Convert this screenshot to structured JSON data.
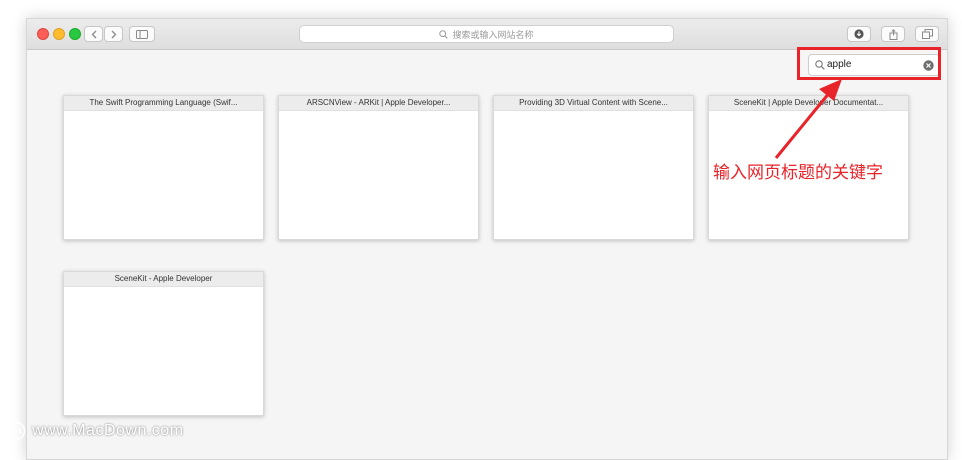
{
  "address_bar": {
    "placeholder": "搜索或输入网站名称"
  },
  "search": {
    "value": "apple"
  },
  "tabs": [
    {
      "title": "The Swift Programming Language (Swif..."
    },
    {
      "title": "ARSCNView - ARKit | Apple Developer..."
    },
    {
      "title": "Providing 3D Virtual Content with Scene..."
    },
    {
      "title": "SceneKit | Apple Developer Documentat..."
    },
    {
      "title": "SceneKit - Apple Developer"
    }
  ],
  "annotation": {
    "text": "输入网页标题的关键字"
  },
  "watermark": {
    "text": "www.MacDown.com"
  },
  "colors": {
    "annotation_red": "#e8232a",
    "window_bg": "#f5f5f5"
  }
}
